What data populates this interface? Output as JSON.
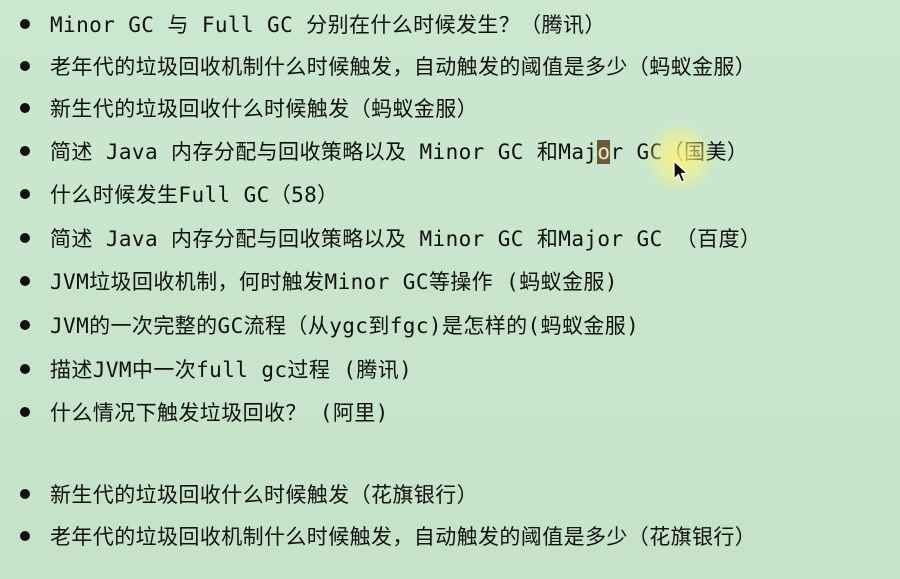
{
  "items": [
    {
      "text": "Minor GC 与 Full GC 分别在什么时候发生？（腾讯）"
    },
    {
      "text": "老年代的垃圾回收机制什么时候触发，自动触发的阈值是多少（蚂蚁金服）"
    },
    {
      "text": "新生代的垃圾回收什么时候触发（蚂蚁金服）"
    },
    {
      "text_before": "简述 Java 内存分配与回收策略以及 Minor GC 和Maj",
      "text_selected": "o",
      "text_after": "r GC（国美）"
    },
    {
      "text": "什么时候发生Full GC（58）"
    },
    {
      "text": "简述 Java 内存分配与回收策略以及 Minor GC 和Major GC （百度）"
    },
    {
      "text": "JVM垃圾回收机制，何时触发Minor GC等操作 (蚂蚁金服)"
    },
    {
      "text": "JVM的一次完整的GC流程（从ygc到fgc)是怎样的(蚂蚁金服)"
    },
    {
      "text": "描述JVM中一次full gc过程 (腾讯)"
    },
    {
      "text": "什么情况下触发垃圾回收？ (阿里)"
    },
    {
      "text": "新生代的垃圾回收什么时候触发（花旗银行）"
    },
    {
      "text": "老年代的垃圾回收机制什么时候触发，自动触发的阈值是多少（花旗银行）"
    }
  ],
  "colors": {
    "background": "#c9e6cd",
    "text": "#111111",
    "selection": "#6b5a3a",
    "cursor_highlight": "#fff578"
  },
  "cursor": {
    "icon": "mouse-pointer-icon"
  }
}
